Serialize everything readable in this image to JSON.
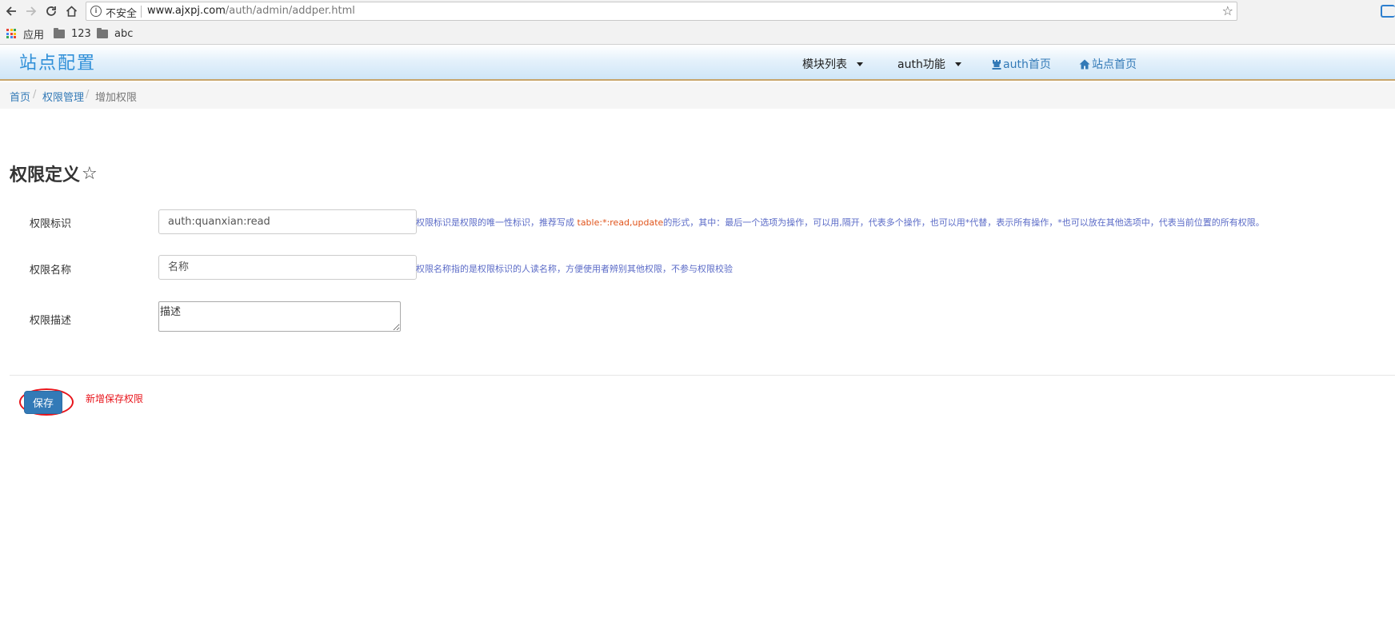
{
  "browser": {
    "security_label": "不安全",
    "url_host": "www.ajxpj.com",
    "url_path": "/auth/admin/addper.html",
    "bookmarks": [
      {
        "label": "应用",
        "icon": "apps-grid-icon"
      },
      {
        "label": "123",
        "icon": "folder-icon"
      },
      {
        "label": "abc",
        "icon": "folder-icon"
      }
    ]
  },
  "header": {
    "site_title": "站点配置",
    "nav": {
      "modules": "模块列表",
      "auth_features": "auth功能",
      "auth_home": "auth首页",
      "site_home": "站点首页"
    }
  },
  "breadcrumb": {
    "home": "首页",
    "perm_mgmt": "权限管理",
    "current": "增加权限",
    "separator": "/"
  },
  "page": {
    "title": "权限定义",
    "title_icon": "star-outline-icon"
  },
  "form": {
    "perm_key": {
      "label": "权限标识",
      "value": "auth:quanxian:read",
      "help_prefix": "权限标识是权限的唯一性标识，推荐写成 ",
      "help_highlight": "table:*:read,update",
      "help_suffix": "的形式，其中：最后一个选项为操作，可以用,隔开，代表多个操作，也可以用*代替，表示所有操作，*也可以放在其他选项中，代表当前位置的所有权限。"
    },
    "perm_name": {
      "label": "权限名称",
      "value": "名称",
      "help": "权限名称指的是权限标识的人读名称，方便使用者辨别其他权限，不参与权限校验"
    },
    "perm_desc": {
      "label": "权限描述",
      "value": "描述"
    }
  },
  "actions": {
    "save_label": "保存",
    "save_note": "新增保存权限"
  },
  "colors": {
    "link": "#337ab7",
    "primary_button": "#337ab7",
    "annotation_red": "#e8141b",
    "help_text": "#5b6bc7",
    "help_highlight": "#e0531a",
    "site_title": "#2f8fd8"
  }
}
